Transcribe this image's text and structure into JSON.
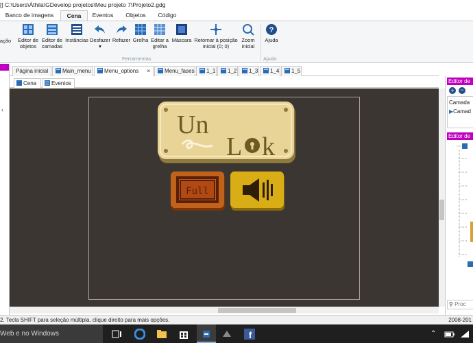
{
  "window": {
    "title": "[] C:\\Users\\Áthila\\GDevelop projetos\\Meu projeto 7\\Projeto2.gdg"
  },
  "ribbon": {
    "tabs": [
      {
        "label": "Banco de imagens"
      },
      {
        "label": "Cena"
      },
      {
        "label": "Eventos"
      },
      {
        "label": "Objetos"
      },
      {
        "label": "Código"
      }
    ],
    "cut_label": "ação",
    "buttons": {
      "object_editor": "Editor de objetos",
      "layer_editor": "Editor de camadas",
      "instances": "Instâncias",
      "undo": "Desfazer",
      "redo": "Refazer",
      "grid": "Grelha",
      "edit_grid": "Editar a grelha",
      "mask": "Máscara",
      "return_to_origin": "Retornar à posição inicial (0; 0)",
      "zoom": "Zoom inicial",
      "help": "Ajuda"
    },
    "groups": {
      "tools": "Ferramentas",
      "help": "Ajuda"
    }
  },
  "scene_tabs": [
    {
      "label": "Página inicial",
      "icon": "none"
    },
    {
      "label": "Main_menu",
      "icon": "scene-icon"
    },
    {
      "label": "Menu_options",
      "icon": "scene-icon",
      "active": true,
      "close": "×"
    },
    {
      "label": "Menu_fases",
      "icon": "scene-icon"
    },
    {
      "label": "1_1",
      "icon": "scene-icon"
    },
    {
      "label": "1_2",
      "icon": "scene-icon"
    },
    {
      "label": "1_3",
      "icon": "scene-icon"
    },
    {
      "label": "1_4",
      "icon": "scene-icon"
    },
    {
      "label": "1_5",
      "icon": "scene-icon"
    }
  ],
  "sub_tabs": [
    {
      "label": "Cena"
    },
    {
      "label": "Eventos"
    }
  ],
  "scene": {
    "logo_text_1": "Un",
    "logo_text_2": "L",
    "logo_text_3": "k",
    "full_button_label": "Full",
    "sound_button": "speaker-icon",
    "background_color": "#3b3631"
  },
  "right_panels": {
    "layers_title": "Editor de",
    "layer_header": "Camada",
    "layer_item": "Camad",
    "objects_title": "Editor de",
    "search_placeholder": "Proc"
  },
  "status": {
    "message": "2. Tecla SHIFT para seleção múltipla, clique direito para mais opções.",
    "right": "2008-201"
  },
  "taskbar": {
    "search_text": "Web e no Windows"
  },
  "colors": {
    "panel_header": "#c000c0",
    "scene_bg": "#3b3631",
    "logo_gold": "#e6cf8a",
    "full_btn": "#b85a12",
    "sound_btn": "#d6a914"
  }
}
